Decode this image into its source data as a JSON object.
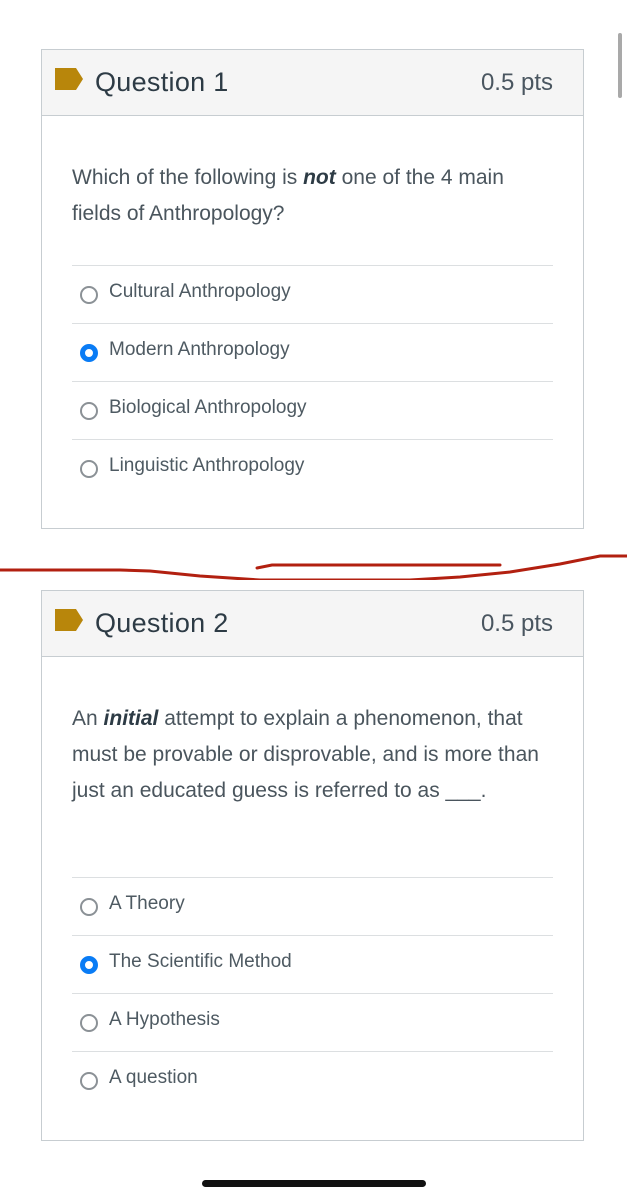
{
  "questions": [
    {
      "title": "Question 1",
      "points": "0.5 pts",
      "text_before": "Which of the following is ",
      "text_emphasis": "not",
      "text_after": " one of the 4 main fields of Anthropology?",
      "answers": [
        {
          "label": "Cultural Anthropology",
          "selected": false
        },
        {
          "label": "Modern Anthropology",
          "selected": true
        },
        {
          "label": "Biological Anthropology",
          "selected": false
        },
        {
          "label": "Linguistic Anthropology",
          "selected": false
        }
      ]
    },
    {
      "title": "Question 2",
      "points": "0.5 pts",
      "text_before": "An ",
      "text_emphasis": "initial",
      "text_after": " attempt to explain a phenomenon, that must be provable or disprovable, and is more than just an educated guess is referred to as ___.",
      "answers": [
        {
          "label": "A Theory",
          "selected": false
        },
        {
          "label": "The Scientific Method",
          "selected": true
        },
        {
          "label": "A Hypothesis",
          "selected": false
        },
        {
          "label": "A question",
          "selected": false
        }
      ]
    }
  ],
  "colors": {
    "flag": "#b8860b",
    "radio_selected": "#0a7cf5",
    "annotation_stroke": "#b22010"
  },
  "icons": {
    "flag": "flag-icon",
    "radio": "radio-button-icon"
  }
}
